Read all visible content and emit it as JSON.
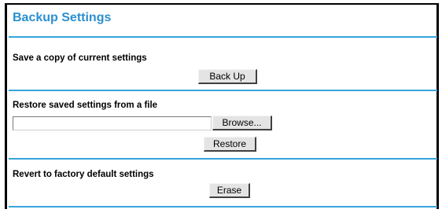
{
  "page": {
    "title": "Backup Settings"
  },
  "sections": {
    "backup": {
      "heading": "Save a copy of current settings",
      "button_label": "Back Up"
    },
    "restore": {
      "heading": "Restore saved settings from a file",
      "file_value": "",
      "browse_label": "Browse...",
      "button_label": "Restore"
    },
    "revert": {
      "heading": "Revert to factory default settings",
      "button_label": "Erase"
    }
  },
  "colors": {
    "title": "#2b8fce",
    "rule": "#35a4dc",
    "button_face": "#e4e4e4"
  }
}
